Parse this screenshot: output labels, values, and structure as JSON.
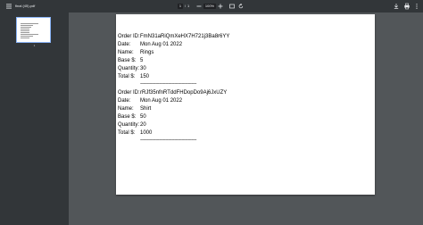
{
  "toolbar": {
    "menu_icon": "hamburger-menu-icon",
    "file_name": "final (45).pdf",
    "page_current": "1",
    "page_separator": "/",
    "page_total": "1",
    "zoom_level": "100%",
    "download_icon": "download-icon",
    "print_icon": "print-icon",
    "more_icon": "more-vertical-icon"
  },
  "sidebar": {
    "thumbnails": [
      {
        "page_number": "1"
      }
    ]
  },
  "labels": {
    "order_id": "Order ID:",
    "date": "Date:",
    "name": "Name:",
    "base": "Base $:",
    "quantity": "Quantity:",
    "total": "Total $:"
  },
  "orders": [
    {
      "order_id": "FmN31aRiQmXeHX7H721j3Ba8r6YY",
      "date": "Mon Aug 01 2022",
      "name": "Rings",
      "base": "5",
      "quantity": "30",
      "total": "150",
      "separator": "------------------------------------------------------"
    },
    {
      "order_id": "rRJf35nfnRTddFHDopDo9Aj6JxUZY",
      "date": "Mon Aug 01 2022",
      "name": "Shirt",
      "base": "50",
      "quantity": "20",
      "total": "1000",
      "separator": "------------------------------------------------------"
    }
  ]
}
